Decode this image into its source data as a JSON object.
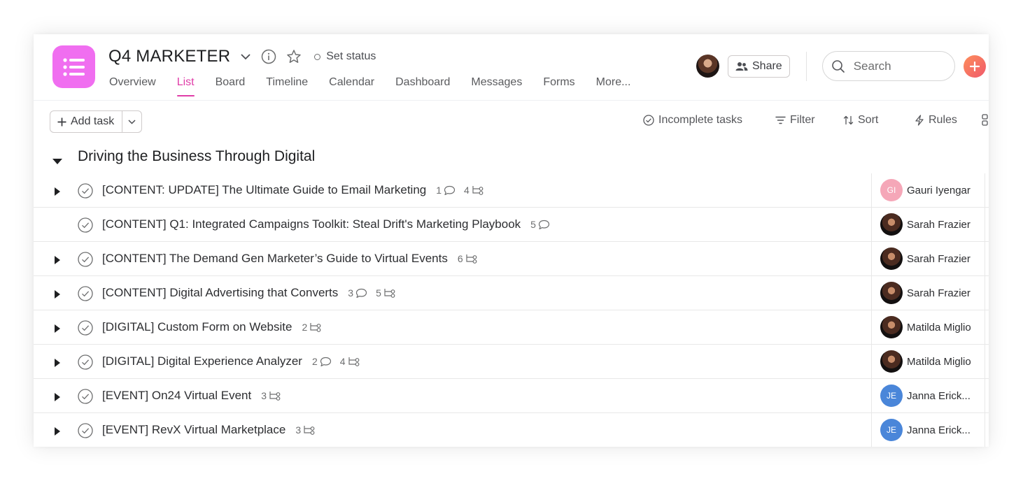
{
  "project": {
    "title": "Q4 MARKETER",
    "set_status": "Set status",
    "icon_color": "#f06ef0"
  },
  "tabs": [
    "Overview",
    "List",
    "Board",
    "Timeline",
    "Calendar",
    "Dashboard",
    "Messages",
    "Forms",
    "More..."
  ],
  "active_tab": "List",
  "header": {
    "share_label": "Share",
    "search_placeholder": "Search"
  },
  "toolbar": {
    "add_task_label": "Add task",
    "incomplete_label": "Incomplete tasks",
    "filter_label": "Filter",
    "sort_label": "Sort",
    "rules_label": "Rules"
  },
  "section": {
    "title": "Driving the Business Through Digital"
  },
  "tasks": [
    {
      "name": "[CONTENT: UPDATE] The Ultimate Guide to Email Marketing",
      "comments": "1",
      "subtasks": "4",
      "expandable": true,
      "assignee": "Gauri Iyengar",
      "initials": "GI",
      "avatar": "gi"
    },
    {
      "name": "[CONTENT] Q1: Integrated Campaigns Toolkit: Steal Drift's Marketing Playbook",
      "comments": "5",
      "subtasks": "",
      "expandable": false,
      "assignee": "Sarah Frazier",
      "initials": "",
      "avatar": "photo"
    },
    {
      "name": "[CONTENT] The Demand Gen Marketer’s Guide to Virtual Events",
      "comments": "",
      "subtasks": "6",
      "expandable": true,
      "assignee": "Sarah Frazier",
      "initials": "",
      "avatar": "photo"
    },
    {
      "name": "[CONTENT] Digital Advertising that Converts",
      "comments": "3",
      "subtasks": "5",
      "expandable": true,
      "assignee": "Sarah Frazier",
      "initials": "",
      "avatar": "photo"
    },
    {
      "name": "[DIGITAL] Custom Form on Website",
      "comments": "",
      "subtasks": "2",
      "expandable": true,
      "assignee": "Matilda Miglio",
      "initials": "",
      "avatar": "photo"
    },
    {
      "name": "[DIGITAL] Digital Experience Analyzer",
      "comments": "2",
      "subtasks": "4",
      "expandable": true,
      "assignee": "Matilda Miglio",
      "initials": "",
      "avatar": "photo"
    },
    {
      "name": "[EVENT] On24 Virtual Event",
      "comments": "",
      "subtasks": "3",
      "expandable": true,
      "assignee": "Janna Erick...",
      "initials": "JE",
      "avatar": "je"
    },
    {
      "name": "[EVENT] RevX Virtual Marketplace",
      "comments": "",
      "subtasks": "3",
      "expandable": true,
      "assignee": "Janna Erick...",
      "initials": "JE",
      "avatar": "je"
    }
  ],
  "colors": {
    "accent_pink": "#e03da8",
    "plus_gradient_start": "#fd8e5b",
    "plus_gradient_end": "#f0596b",
    "avatar_gi": "#f5a7b8",
    "avatar_je": "#4a86d9"
  }
}
